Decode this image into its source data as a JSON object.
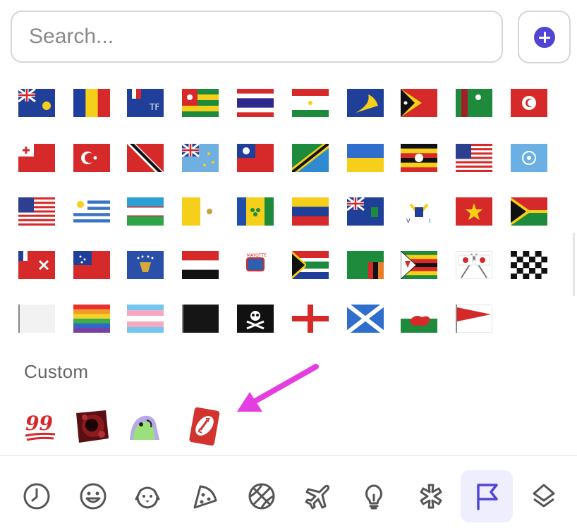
{
  "search": {
    "placeholder": "Search..."
  },
  "add_button": {
    "icon": "plus-circle-icon",
    "color": "#5145d6"
  },
  "flags": [
    {
      "name": "turks-caicos-flag"
    },
    {
      "name": "chad-flag"
    },
    {
      "name": "french-southern-territories-flag"
    },
    {
      "name": "togo-flag"
    },
    {
      "name": "thailand-flag"
    },
    {
      "name": "tajikistan-flag"
    },
    {
      "name": "tokelau-flag"
    },
    {
      "name": "timor-leste-flag"
    },
    {
      "name": "turkmenistan-flag"
    },
    {
      "name": "tunisia-flag"
    },
    {
      "name": "tonga-flag"
    },
    {
      "name": "turkey-flag"
    },
    {
      "name": "trinidad-tobago-flag"
    },
    {
      "name": "tuvalu-flag"
    },
    {
      "name": "taiwan-flag"
    },
    {
      "name": "tanzania-flag"
    },
    {
      "name": "ukraine-flag"
    },
    {
      "name": "uganda-flag"
    },
    {
      "name": "us-outlying-islands-flag"
    },
    {
      "name": "united-nations-flag"
    },
    {
      "name": "united-states-flag"
    },
    {
      "name": "uruguay-flag"
    },
    {
      "name": "uzbekistan-flag"
    },
    {
      "name": "vatican-city-flag"
    },
    {
      "name": "st-vincent-grenadines-flag"
    },
    {
      "name": "venezuela-flag"
    },
    {
      "name": "british-virgin-islands-flag"
    },
    {
      "name": "us-virgin-islands-flag"
    },
    {
      "name": "vietnam-flag"
    },
    {
      "name": "vanuatu-flag"
    },
    {
      "name": "wallis-futuna-flag"
    },
    {
      "name": "samoa-flag"
    },
    {
      "name": "kosovo-flag"
    },
    {
      "name": "yemen-flag"
    },
    {
      "name": "mayotte-flag"
    },
    {
      "name": "south-africa-flag"
    },
    {
      "name": "zambia-flag"
    },
    {
      "name": "zimbabwe-flag"
    },
    {
      "name": "crossed-flags"
    },
    {
      "name": "chequered-flag"
    },
    {
      "name": "white-flag"
    },
    {
      "name": "rainbow-flag"
    },
    {
      "name": "transgender-flag"
    },
    {
      "name": "black-flag"
    },
    {
      "name": "pirate-flag"
    },
    {
      "name": "england-flag"
    },
    {
      "name": "scotland-flag"
    },
    {
      "name": "wales-flag"
    },
    {
      "name": "triangular-flag"
    }
  ],
  "custom_section": {
    "label": "Custom",
    "emojis": [
      {
        "name": "hundred-points-emoji",
        "text": "99"
      },
      {
        "name": "dark-red-blob-emoji"
      },
      {
        "name": "parrot-emoji"
      },
      {
        "name": "uno-reverse-card-emoji"
      }
    ]
  },
  "annotation": {
    "icon": "pointer-arrow-icon",
    "color": "#e53ee0"
  },
  "category_tabs": [
    {
      "name": "tab-recent",
      "icon": "clock-icon",
      "active": false
    },
    {
      "name": "tab-smileys",
      "icon": "smiley-icon",
      "active": false
    },
    {
      "name": "tab-animals",
      "icon": "dog-icon",
      "active": false
    },
    {
      "name": "tab-food",
      "icon": "pizza-icon",
      "active": false
    },
    {
      "name": "tab-activities",
      "icon": "basketball-icon",
      "active": false
    },
    {
      "name": "tab-travel",
      "icon": "airplane-icon",
      "active": false
    },
    {
      "name": "tab-objects",
      "icon": "lightbulb-icon",
      "active": false
    },
    {
      "name": "tab-symbols",
      "icon": "asterisk-icon",
      "active": false
    },
    {
      "name": "tab-flags",
      "icon": "flag-icon",
      "active": true
    },
    {
      "name": "tab-custom",
      "icon": "layers-icon",
      "active": false
    }
  ],
  "colors": {
    "accent": "#5145d6",
    "active_tab_bg": "#eeeeff",
    "icon_gray": "#555555"
  }
}
